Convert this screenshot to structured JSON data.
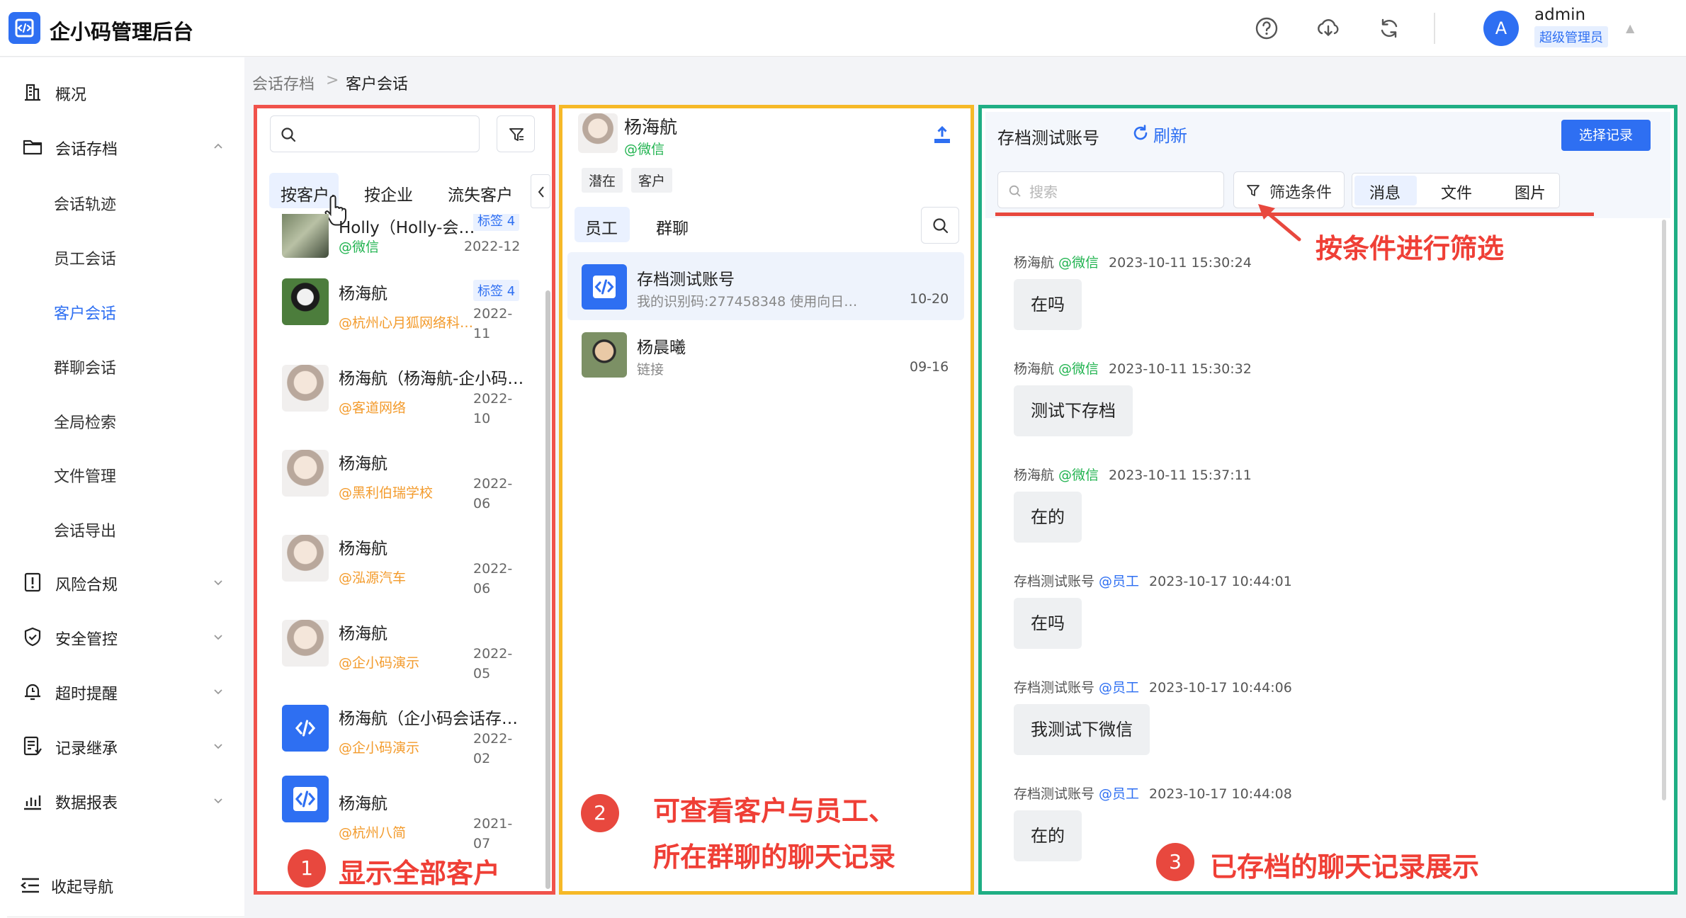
{
  "app": {
    "title": "企小码管理后台"
  },
  "header": {
    "icons": [
      "help-icon",
      "download-icon",
      "refresh-icon"
    ],
    "user": {
      "avatar_letter": "A",
      "name": "admin",
      "role": "超级管理员"
    }
  },
  "sidebar": {
    "items": [
      {
        "label": "概况",
        "icon": "building-icon"
      },
      {
        "label": "会话存档",
        "icon": "folder-icon",
        "expanded": true
      },
      {
        "label": "会话轨迹"
      },
      {
        "label": "员工会话"
      },
      {
        "label": "客户会话",
        "active": true
      },
      {
        "label": "群聊会话"
      },
      {
        "label": "全局检索"
      },
      {
        "label": "文件管理"
      },
      {
        "label": "会话导出"
      },
      {
        "label": "风险合规",
        "icon": "alert-icon"
      },
      {
        "label": "安全管控",
        "icon": "shield-icon"
      },
      {
        "label": "超时提醒",
        "icon": "bell-icon"
      },
      {
        "label": "记录继承",
        "icon": "record-icon"
      },
      {
        "label": "数据报表",
        "icon": "chart-icon"
      }
    ],
    "collapse_label": "收起导航"
  },
  "breadcrumb": {
    "parent": "会话存档",
    "sep": ">",
    "current": "客户会话"
  },
  "customers": {
    "tabs": [
      "按客户",
      "按企业",
      "流失客户"
    ],
    "list": [
      {
        "name": "Holly（Holly-会…",
        "org": "@微信",
        "date": "2022-12",
        "tag": "标签 4"
      },
      {
        "name": "杨海航",
        "org": "@杭州心月狐网络科…",
        "date": "2022-\n11",
        "tag": "标签 4"
      },
      {
        "name": "杨海航（杨海航-企小码…",
        "org": "@客道网络",
        "date": "2022-\n10"
      },
      {
        "name": "杨海航",
        "org": "@黑利伯瑞学校",
        "date": "2022-\n06"
      },
      {
        "name": "杨海航",
        "org": "@泓源汽车",
        "date": "2022-\n06"
      },
      {
        "name": "杨海航",
        "org": "@企小码演示",
        "date": "2022-\n05"
      },
      {
        "name": "杨海航（企小码会话存…",
        "org": "@企小码演示",
        "date": "2022-\n02"
      },
      {
        "name": "杨海航",
        "org": "@杭州八简",
        "date": "2021-\n07"
      }
    ]
  },
  "middle": {
    "customer_name": "杨海航",
    "customer_source": "@微信",
    "tags": [
      "潜在",
      "客户"
    ],
    "tabs": [
      "员工",
      "群聊"
    ],
    "chats": [
      {
        "name": "存档测试账号",
        "sub": "我的识别码:277458348 使用向日…",
        "date": "10-20"
      },
      {
        "name": "杨晨曦",
        "sub": "链接",
        "date": "09-16"
      }
    ]
  },
  "right": {
    "title": "存档测试账号",
    "refresh_label": "刷新",
    "select_button": "选择记录",
    "search_placeholder": "搜索",
    "filter_label": "筛选条件",
    "segments": [
      "消息",
      "文件",
      "图片"
    ],
    "messages": [
      {
        "sender": "杨海航",
        "source": "@微信",
        "time": "2023-10-11 15:30:24",
        "text": "在吗"
      },
      {
        "sender": "杨海航",
        "source": "@微信",
        "time": "2023-10-11 15:30:32",
        "text": "测试下存档"
      },
      {
        "sender": "杨海航",
        "source": "@微信",
        "time": "2023-10-11 15:37:11",
        "text": "在的"
      },
      {
        "sender": "存档测试账号",
        "source": "@员工",
        "time": "2023-10-17 10:44:01",
        "text": "在吗"
      },
      {
        "sender": "存档测试账号",
        "source": "@员工",
        "time": "2023-10-17 10:44:06",
        "text": "我测试下微信"
      },
      {
        "sender": "存档测试账号",
        "source": "@员工",
        "time": "2023-10-17 10:44:08",
        "text": "在的"
      }
    ]
  },
  "annotations": {
    "one_number": "1",
    "one_text": "显示全部客户",
    "two_number": "2",
    "two_line1": "可查看客户与员工、",
    "two_line2": "所在群聊的聊天记录",
    "three_number": "3",
    "three_text": "已存档的聊天记录展示",
    "filter_text": "按条件进行筛选"
  },
  "colors": {
    "primary": "#2e6ff2",
    "red_box": "#f0524b",
    "yellow_box": "#f6b927",
    "green_box": "#1fae84",
    "annotation": "#ef3f36"
  }
}
